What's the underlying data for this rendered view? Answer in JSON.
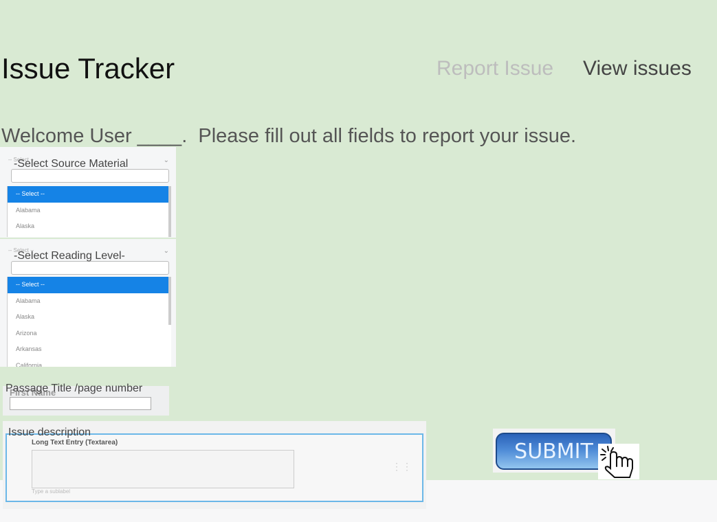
{
  "app": {
    "title": "Issue Tracker"
  },
  "nav": {
    "report": "Report Issue",
    "view": "View issues"
  },
  "welcome": "Welcome User ____.  Please fill out all fields to report your issue.",
  "source_select": {
    "label": "-Select Source Material",
    "header": "-- Select --",
    "options": [
      "-- Select --",
      "Alabama",
      "Alaska"
    ]
  },
  "reading_select": {
    "label": "-Select Reading Level-",
    "header": "-- Select --",
    "options": [
      "-- Select --",
      "Alabama",
      "Alaska",
      "Arizona",
      "Arkansas",
      "California"
    ]
  },
  "passage": {
    "label": "Passage Title /page number",
    "ghost": "First Name"
  },
  "description": {
    "label": "Issue description",
    "ghost_title": "Long Text Entry (Textarea)",
    "sublabel": "Type a sublabel"
  },
  "submit": {
    "label": "SUBMIT"
  },
  "colors": {
    "background": "#d9ead3",
    "selected": "#1583e6",
    "submit": "#2a62b8"
  }
}
